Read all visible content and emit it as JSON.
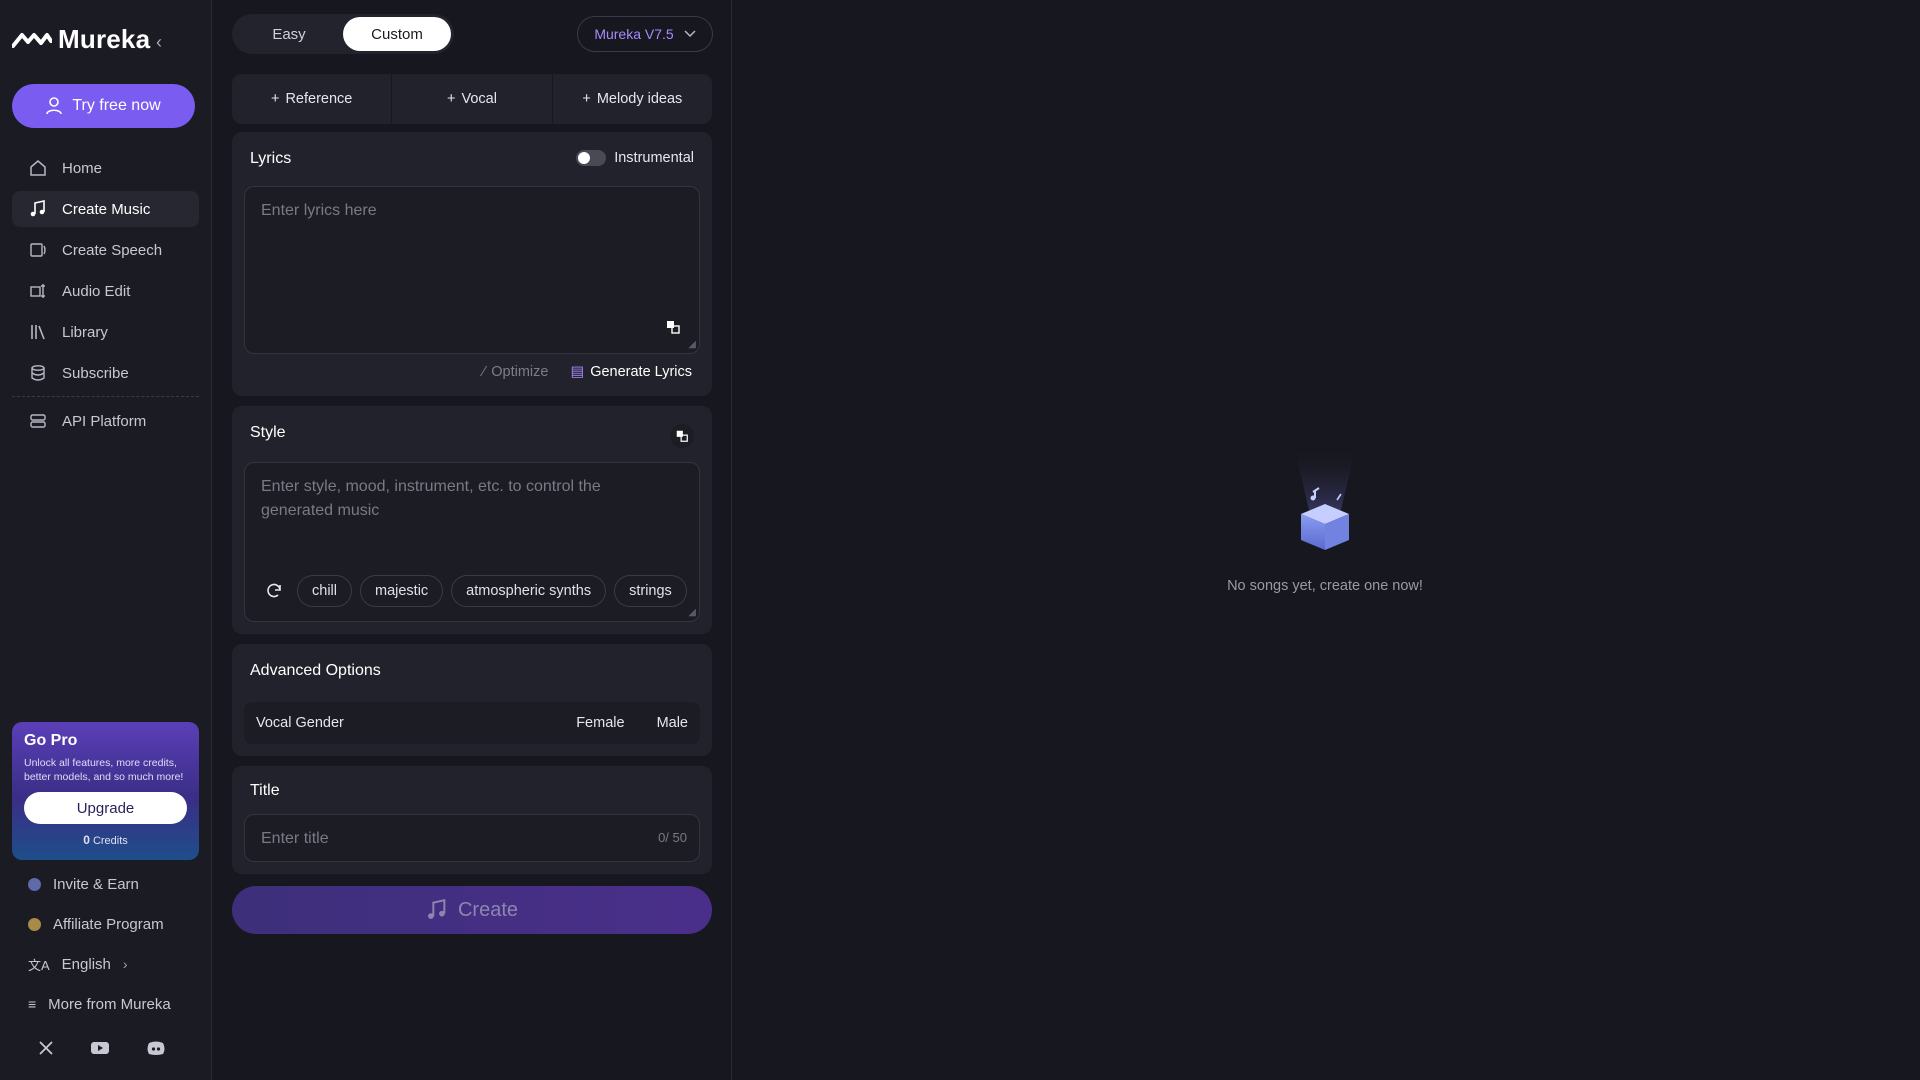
{
  "app": {
    "name": "Mureka"
  },
  "sidebar": {
    "try_label": "Try free now",
    "items": [
      {
        "label": "Home",
        "icon": "home-icon"
      },
      {
        "label": "Create Music",
        "icon": "music-note-icon",
        "active": true
      },
      {
        "label": "Create Speech",
        "icon": "speech-icon"
      },
      {
        "label": "Audio Edit",
        "icon": "audio-edit-icon"
      },
      {
        "label": "Library",
        "icon": "library-icon"
      },
      {
        "label": "Subscribe",
        "icon": "database-icon"
      }
    ],
    "api_label": "API Platform",
    "gopro": {
      "title": "Go Pro",
      "desc": "Unlock all features, more credits, better models, and so much more!",
      "upgrade_label": "Upgrade",
      "credits_value": "0",
      "credits_unit": "Credits"
    },
    "bottom": [
      {
        "label": "Invite & Earn",
        "icon": "invite-icon"
      },
      {
        "label": "Affiliate Program",
        "icon": "affiliate-icon"
      },
      {
        "label": "English",
        "icon": "language-icon"
      },
      {
        "label": "More from Mureka",
        "icon": "menu-icon"
      }
    ],
    "social": [
      "x-icon",
      "youtube-icon",
      "discord-icon"
    ]
  },
  "panel": {
    "modes": [
      "Easy",
      "Custom"
    ],
    "active_mode": "Custom",
    "model": "Mureka V7.5",
    "tabs": [
      "Reference",
      "Vocal",
      "Melody ideas"
    ],
    "lyrics": {
      "title": "Lyrics",
      "instrumental_label": "Instrumental",
      "instrumental_on": false,
      "placeholder": "Enter lyrics here",
      "optimize_label": "Optimize",
      "generate_label": "Generate Lyrics"
    },
    "style": {
      "title": "Style",
      "placeholder": "Enter style, mood, instrument, etc. to control the generated music",
      "chips": [
        "chill",
        "majestic",
        "atmospheric synths",
        "strings"
      ]
    },
    "advanced": {
      "title": "Advanced Options",
      "vocal_gender_label": "Vocal Gender",
      "options": [
        "Female",
        "Male"
      ]
    },
    "title_field": {
      "title": "Title",
      "placeholder": "Enter title",
      "counter": "0/ 50"
    },
    "create_label": "Create"
  },
  "results": {
    "empty_text": "No songs yet, create one now!"
  },
  "colors": {
    "accent": "#7a5cf0",
    "model_text": "#a78bfa",
    "background": "#17171f"
  }
}
